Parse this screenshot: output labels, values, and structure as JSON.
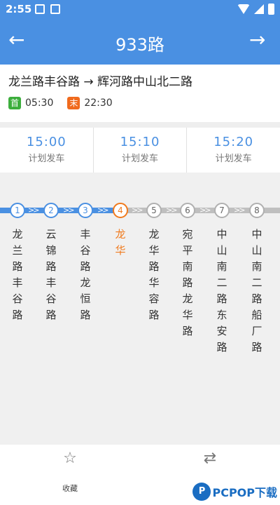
{
  "status_bar": {
    "time": "2:55"
  },
  "nav": {
    "title": "933路",
    "back_icon": "←",
    "forward_icon": "→"
  },
  "route": {
    "direction": "龙兰路丰谷路 → 辉河路中山北二路",
    "first_badge": "首",
    "first_time": "05:30",
    "last_badge": "末",
    "last_time": "22:30"
  },
  "departures": [
    {
      "time": "15:00",
      "label": "计划发车"
    },
    {
      "time": "15:10",
      "label": "计划发车"
    },
    {
      "time": "15:20",
      "label": "计划发车"
    }
  ],
  "stations": [
    {
      "num": "1",
      "name": "龙兰路丰谷路"
    },
    {
      "num": "2",
      "name": "云锦路丰谷路"
    },
    {
      "num": "3",
      "name": "丰谷路龙恒路"
    },
    {
      "num": "4",
      "name": "龙华"
    },
    {
      "num": "5",
      "name": "龙华路华容路"
    },
    {
      "num": "6",
      "name": "宛平南路龙华路"
    },
    {
      "num": "7",
      "name": "中山南二路东安路"
    },
    {
      "num": "8",
      "name": "中山南二路船厂路"
    }
  ],
  "current_station": "4",
  "bottom": {
    "favorite_label": "收藏",
    "favorite_icon": "☆",
    "switch_icon": "⇄"
  },
  "watermark": {
    "logo": "P",
    "text": "PCPOP下载"
  },
  "colors": {
    "primary": "#4a90e2",
    "current": "#f07a1d",
    "first": "#3cae3c",
    "last": "#f06a1d"
  }
}
